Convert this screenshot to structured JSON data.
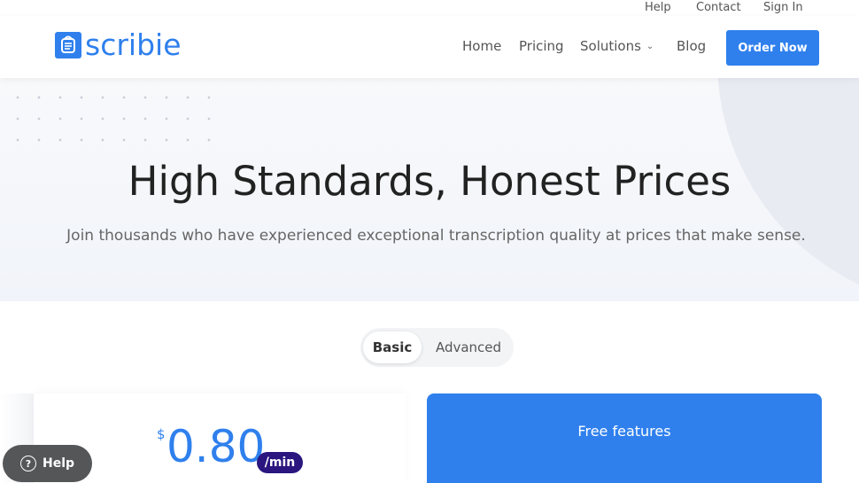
{
  "topbar": {
    "help": "Help",
    "contact": "Contact",
    "sign_in": "Sign In"
  },
  "brand": {
    "name": "scribie",
    "color": "#2f80ed"
  },
  "nav": {
    "home": "Home",
    "pricing": "Pricing",
    "solutions": "Solutions",
    "blog": "Blog",
    "cta": "Order Now"
  },
  "hero": {
    "title": "High Standards, Honest Prices",
    "subtitle": "Join thousands who have experienced exceptional transcription quality at prices that make sense."
  },
  "plan_toggle": {
    "options": [
      "Basic",
      "Advanced"
    ],
    "selected": "Basic"
  },
  "price": {
    "currency": "$",
    "value": "0.80",
    "unit": "/min"
  },
  "features": {
    "title": "Free features"
  },
  "help_button": {
    "label": "Help"
  },
  "colors": {
    "accent": "#2f80ed",
    "badge": "#2b1680"
  }
}
